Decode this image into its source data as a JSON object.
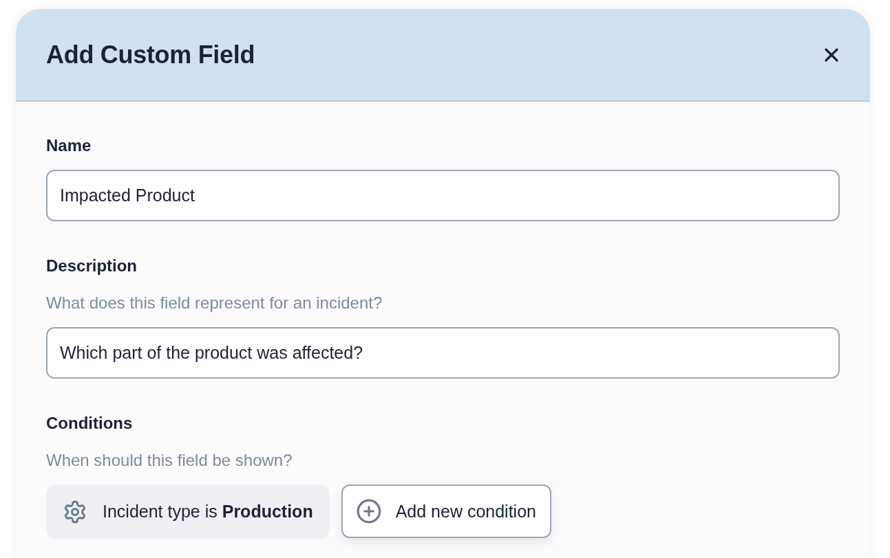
{
  "dialog": {
    "title": "Add Custom Field"
  },
  "fields": [
    {
      "kind": "text",
      "label": "Name",
      "value": "Impacted Product"
    },
    {
      "kind": "text",
      "label": "Description",
      "hint": "What does this field represent for an incident?",
      "value": "Which part of the product was affected?"
    },
    {
      "kind": "conditions",
      "label": "Conditions",
      "hint": "When should this field be shown?",
      "conditions": [
        "Incident type is **Production**"
      ],
      "add_button": "Add new condition"
    }
  ]
}
